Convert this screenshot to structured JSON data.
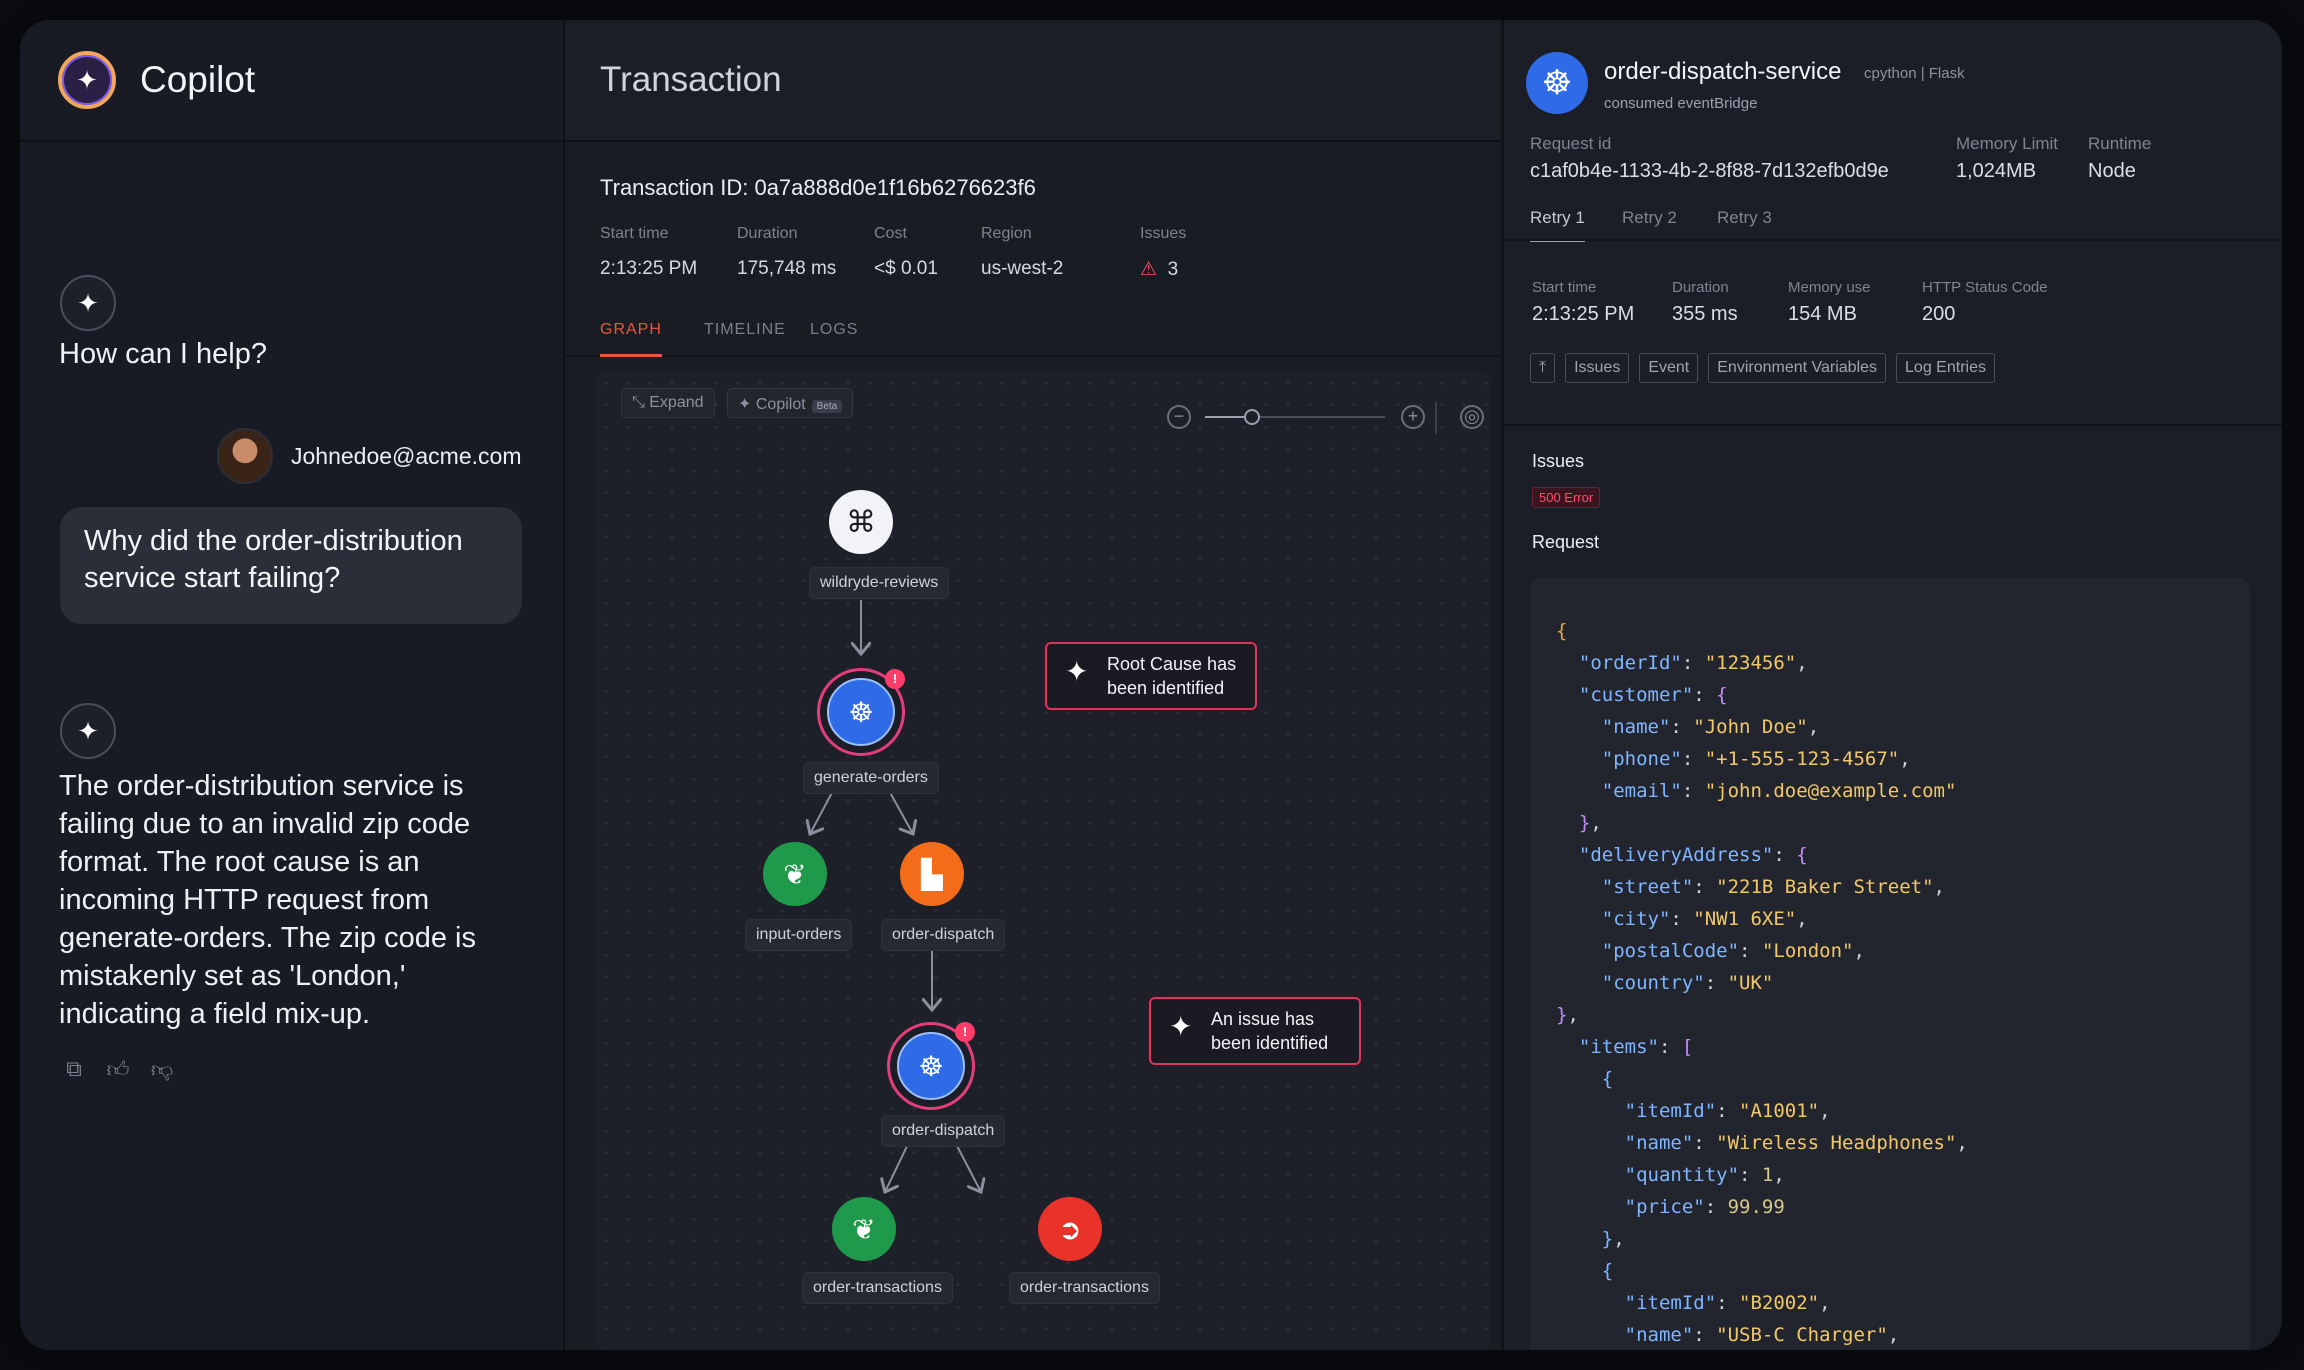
{
  "copilot": {
    "brand": "Copilot",
    "greeting": "How can I help?",
    "user_email": "Johnedoe@acme.com",
    "question": "Why did the order-distribution service start failing?",
    "answer": "The order-distribution service is failing due to an invalid zip code format. The root cause is an incoming HTTP request from generate-orders. The zip code is mistakenly set as 'London,' indicating a field mix-up."
  },
  "transaction": {
    "title": "Transaction",
    "id_label": "Transaction ID: 0a7a888d0e1f16b6276623f6",
    "meta": [
      {
        "label": "Start time",
        "value": "2:13:25 PM"
      },
      {
        "label": "Duration",
        "value": "175,748 ms"
      },
      {
        "label": "Cost",
        "value": "<$ 0.01"
      },
      {
        "label": "Region",
        "value": "us-west-2"
      },
      {
        "label": "Issues",
        "value": "3"
      }
    ],
    "tabs": [
      "GRAPH",
      "TIMELINE",
      "LOGS"
    ],
    "toolbar": {
      "expand": "Expand",
      "copilot": "Copilot",
      "beta": "Beta",
      "zoom_level": 0.26
    },
    "nodes": {
      "n1": "wildryde-reviews",
      "n2": "generate-orders",
      "n3": "input-orders",
      "n4": "order-dispatch",
      "n5": "order-dispatch",
      "n6": "order-transactions",
      "n7": "order-transactions"
    },
    "callouts": {
      "root_cause": "Root Cause has been identified",
      "issue": "An issue has been identified"
    }
  },
  "details": {
    "service_name": "order-dispatch-service",
    "service_tags": "cpython  |  Flask",
    "service_sub": "consumed eventBridge",
    "request_id_label": "Request id",
    "request_id": "c1af0b4e-1133-4b-2-8f88-7d132efb0d9e",
    "memory_limit_label": "Memory Limit",
    "memory_limit": "1,024MB",
    "runtime_label": "Runtime",
    "runtime": "Node",
    "retry_tabs": [
      "Retry 1",
      "Retry 2",
      "Retry 3"
    ],
    "stats": [
      {
        "label": "Start time",
        "value": "2:13:25 PM"
      },
      {
        "label": "Duration",
        "value": "355 ms"
      },
      {
        "label": "Memory use",
        "value": "154 MB"
      },
      {
        "label": "HTTP Status Code",
        "value": "200"
      }
    ],
    "chips": [
      "Issues",
      "Event",
      "Environment Variables",
      "Log Entries"
    ],
    "issues_heading": "Issues",
    "error_badge": "500 Error",
    "request_heading": "Request"
  },
  "colors": {
    "accent": "#e8553e",
    "alert": "#ff3d6a",
    "k8s_blue": "#2f6be6",
    "mongo_green": "#1f9a4a",
    "queue_orange": "#f26c1a",
    "red_service": "#e8322a"
  }
}
